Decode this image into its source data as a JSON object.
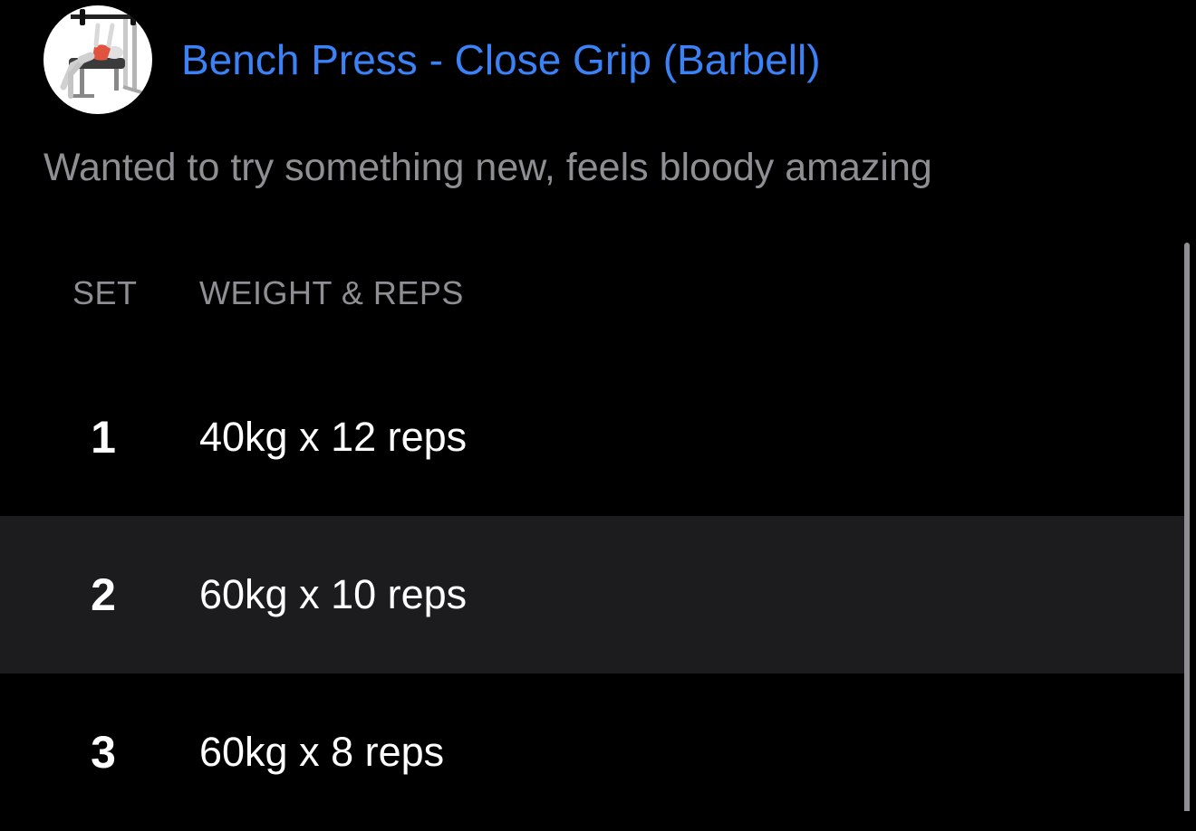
{
  "exercise": {
    "title": "Bench Press - Close Grip (Barbell)",
    "thumbnail_icon": "bench-press-illustration-icon",
    "note": "Wanted to try something new, feels bloody amazing"
  },
  "table": {
    "headers": {
      "set": "SET",
      "weight_reps": "WEIGHT & REPS"
    },
    "rows": [
      {
        "set": "1",
        "weight_reps": "40kg x 12 reps"
      },
      {
        "set": "2",
        "weight_reps": "60kg x 10 reps"
      },
      {
        "set": "3",
        "weight_reps": "60kg x 8 reps"
      }
    ]
  },
  "colors": {
    "background": "#000000",
    "title_accent": "#3b82f6",
    "secondary_text": "#8e8e93",
    "row_highlight": "#1c1c1e",
    "primary_text": "#ffffff"
  }
}
